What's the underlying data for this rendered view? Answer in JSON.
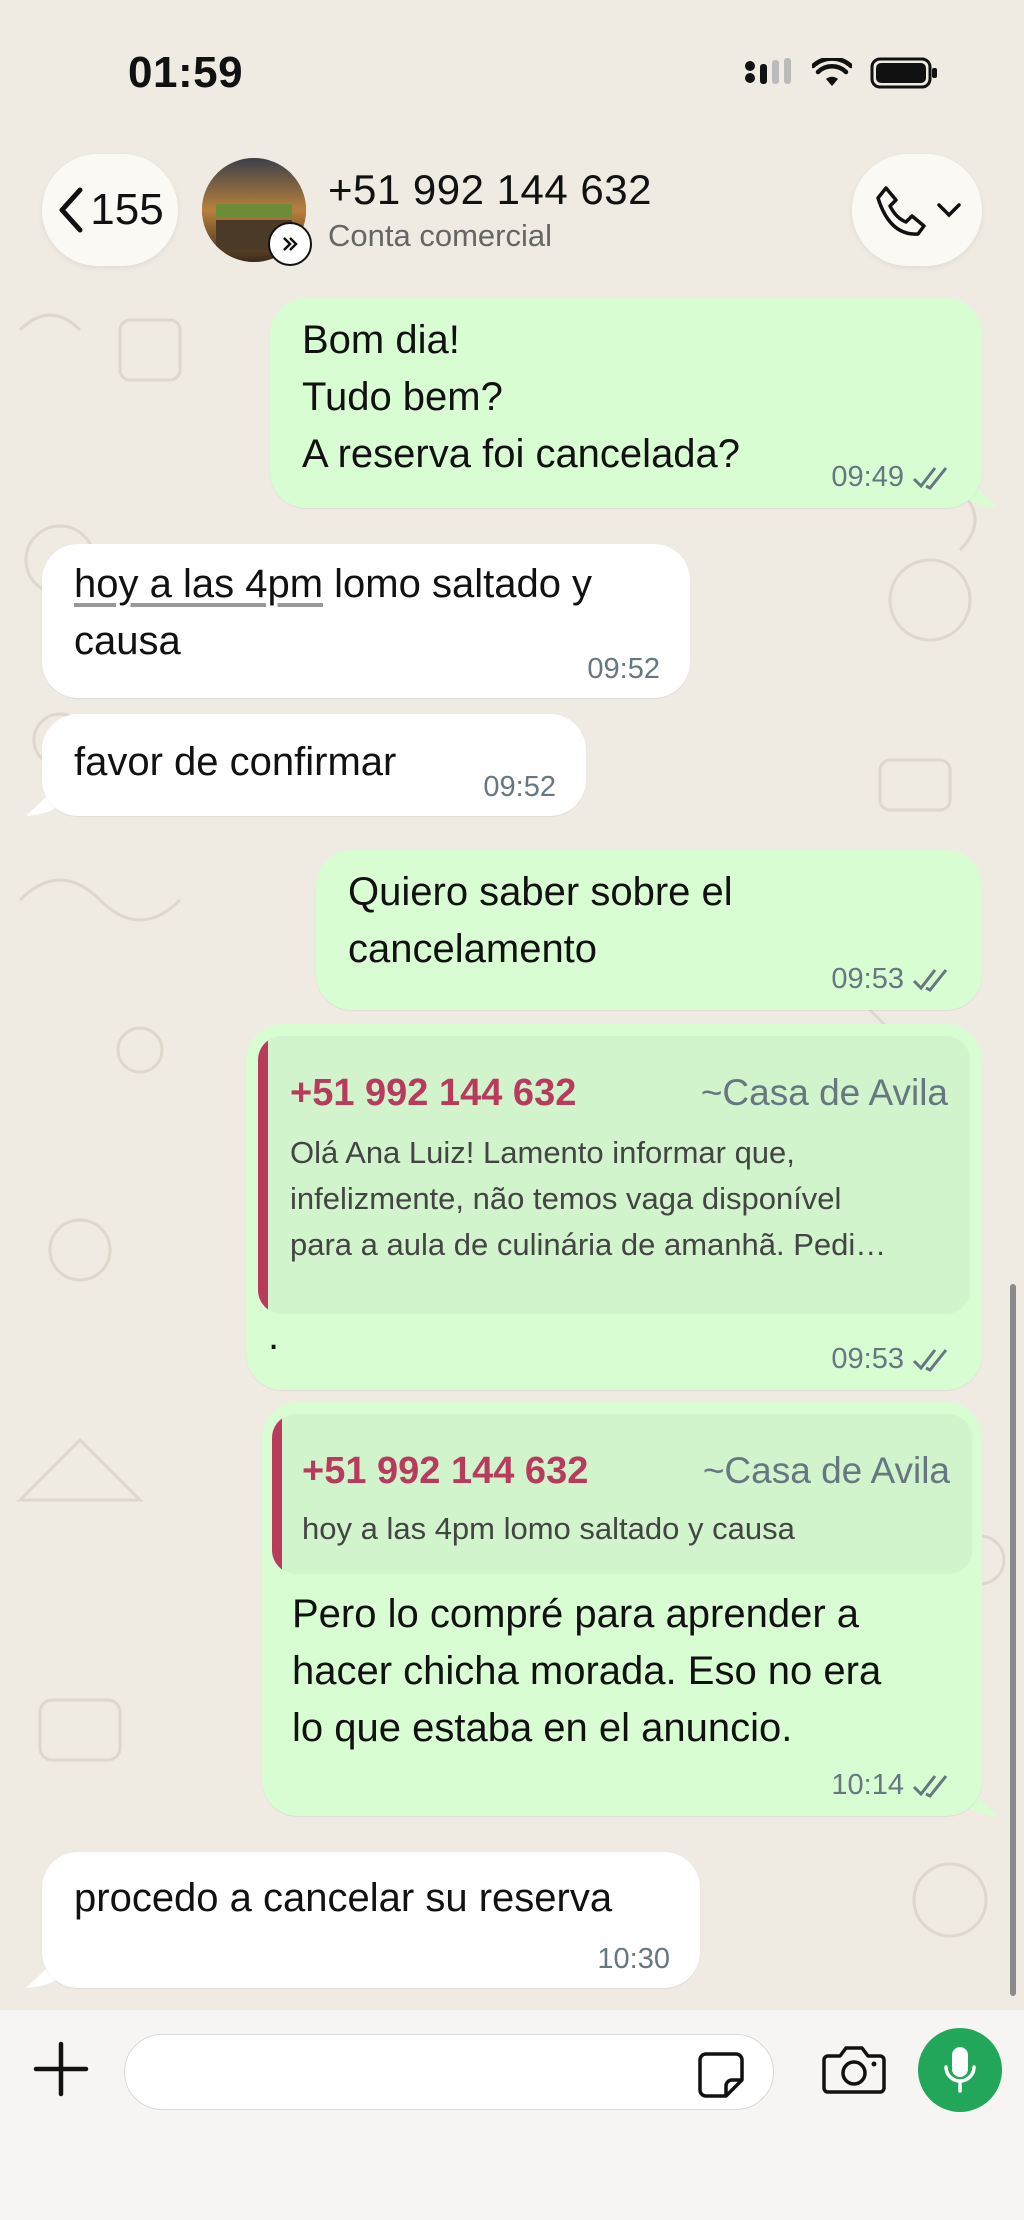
{
  "status_bar": {
    "time": "01:59"
  },
  "header": {
    "back_count": "155",
    "contact_name": "+51 992 144 632",
    "contact_subtitle": "Conta comercial"
  },
  "messages": [
    {
      "direction": "out",
      "text": "Bom dia!\nTudo bem?\nA reserva foi cancelada?",
      "time": "09:49",
      "read": true
    },
    {
      "direction": "in",
      "text_link": "hoy a las 4pm",
      "text": " lomo saltado y\ncausa",
      "time": "09:52"
    },
    {
      "direction": "in",
      "text": "favor de confirmar",
      "time": "09:52"
    },
    {
      "direction": "out",
      "text": "Quiero saber sobre el\ncancelamento",
      "time": "09:53",
      "read": true
    },
    {
      "direction": "out",
      "quote": {
        "name": "+51 992 144 632",
        "alias": "~Casa de Avila",
        "text": "Olá Ana Luiz! Lamento informar que,\ninfelizmente, não temos vaga disponível\npara a aula de culinária de amanhã. Pedi…"
      },
      "text": ".",
      "time": "09:53",
      "read": true
    },
    {
      "direction": "out",
      "quote": {
        "name": "+51 992 144 632",
        "alias": "~Casa de Avila",
        "text": "hoy a las 4pm lomo saltado y causa"
      },
      "text": "Pero lo compré para aprender a\nhacer chicha morada. Eso no era\nlo que estaba en el anuncio.",
      "time": "10:14",
      "read": true
    },
    {
      "direction": "in",
      "text": "procedo a cancelar su reserva",
      "time": "10:30"
    }
  ],
  "composer": {
    "value": "",
    "placeholder": ""
  },
  "colors": {
    "outgoing": "#d9fdd3",
    "incoming": "#ffffff",
    "quote_accent": "#b83b5e",
    "mic": "#21a65a",
    "background": "#efeae2"
  },
  "icons": [
    "back-chevron-icon",
    "business-badge-icon",
    "phone-icon",
    "chevron-down-icon",
    "read-receipt-icon",
    "plus-icon",
    "sticker-icon",
    "camera-icon",
    "microphone-icon",
    "signal-icon",
    "wifi-icon",
    "battery-icon"
  ]
}
